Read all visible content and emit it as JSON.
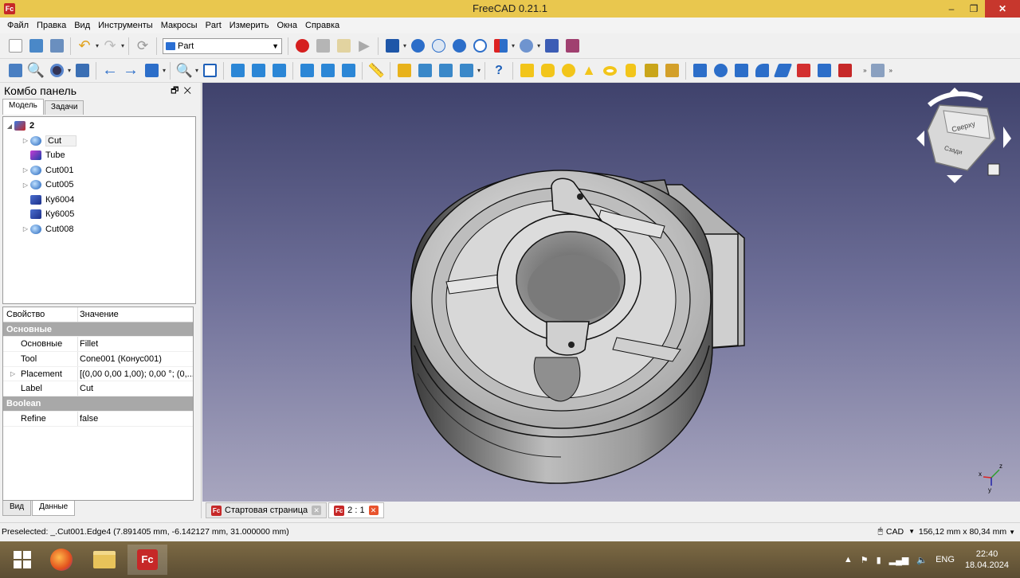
{
  "window": {
    "title": "FreeCAD 0.21.1",
    "app_icon": "Fc",
    "minimize": "–",
    "restore": "❐",
    "close": "✕"
  },
  "menu": [
    "Файл",
    "Правка",
    "Вид",
    "Инструменты",
    "Макросы",
    "Part",
    "Измерить",
    "Окна",
    "Справка"
  ],
  "toolbar": {
    "workbench": "Part"
  },
  "combo": {
    "title": "Комбо панель",
    "tabs": [
      "Модель",
      "Задачи"
    ],
    "tree": [
      {
        "label": "2",
        "expander": "◢",
        "icon": "part-icon"
      },
      {
        "label": "Cut",
        "expander": "▷",
        "icon": "cut-icon"
      },
      {
        "label": "Tube",
        "expander": "",
        "icon": "tube-icon"
      },
      {
        "label": "Cut001",
        "expander": "▷",
        "icon": "cut-icon"
      },
      {
        "label": "Cut005",
        "expander": "▷",
        "icon": "cut-icon"
      },
      {
        "label": "Ку6004",
        "expander": "",
        "icon": "cube-icon"
      },
      {
        "label": "Ку6005",
        "expander": "",
        "icon": "cube-icon"
      },
      {
        "label": "Cut008",
        "expander": "▷",
        "icon": "cut-icon"
      }
    ],
    "props_header": {
      "key": "Свойство",
      "value": "Значение"
    },
    "groups": [
      {
        "name": "Основные",
        "rows": [
          {
            "key": "Основные",
            "value": "Fillet"
          },
          {
            "key": "Tool",
            "value": "Cone001 (Конус001)"
          },
          {
            "key": "Placement",
            "value": "[(0,00 0,00 1,00); 0,00 °; (0,..."
          },
          {
            "key": "Label",
            "value": "Cut"
          }
        ]
      },
      {
        "name": "Boolean",
        "rows": [
          {
            "key": "Refine",
            "value": "false"
          }
        ]
      }
    ],
    "bottom_tabs": [
      "Вид",
      "Данные"
    ]
  },
  "navcube": {
    "top_face": "Сверху",
    "front_face": "Сзади"
  },
  "axes": {
    "x": "x",
    "y": "y",
    "z": "z"
  },
  "doc_tabs": [
    {
      "label": "Стартовая страница",
      "close": "✕"
    },
    {
      "label": "2 : 1",
      "close": "✕"
    }
  ],
  "status": {
    "preselected": "Preselected: _.Cut001.Edge4 (7.891405 mm, -6.142127 mm, 31.000000 mm)",
    "nav_style": "CAD",
    "dims": "156,12 mm x 80,34 mm"
  },
  "taskbar": {
    "lang": "ENG",
    "time": "22:40",
    "date": "18.04.2024"
  }
}
